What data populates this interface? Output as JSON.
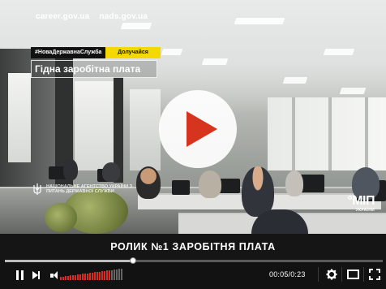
{
  "video": {
    "sites": [
      "career.gov.ua",
      "nads.gov.ua"
    ],
    "hashtag": "#НоваДержавнаСлужба",
    "join_label": "Долучайся",
    "headline": "Гідна заробітна плата",
    "agency": "Національне агентство України з питань державної служби",
    "logo_big": "°МІП",
    "logo_small": "УКРАЇНИ",
    "subtitle": "РОЛИК №1 ЗАРОБІТНЯ ПЛАТА",
    "colors": {
      "accent_play": "#d6341f",
      "tag_yellow": "#f5d800",
      "volume_red": "#d62c24"
    }
  },
  "controls": {
    "time": "00:05/0:23",
    "progress": 0.34,
    "volume_level": 0.8,
    "icons": [
      "pause-icon",
      "next-icon",
      "volume-icon",
      "settings-gear-icon",
      "theater-mode-icon",
      "fullscreen-icon"
    ]
  }
}
